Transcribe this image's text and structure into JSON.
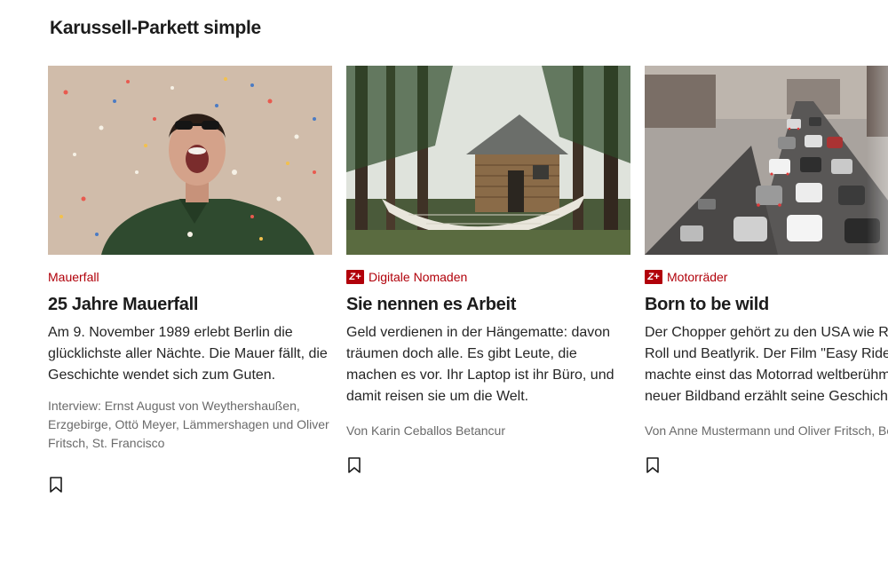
{
  "section": {
    "title": "Karussell-Parkett simple"
  },
  "cards": [
    {
      "image_alt": "Person mit Sonnenbrille jubelt im Konfettiregen",
      "zplus": false,
      "kicker": "Mauerfall",
      "headline": "25 Jahre Mauerfall",
      "teaser": "Am 9. November 1989 erlebt Berlin die glücklichste aller Nächte. Die Mauer fällt, die Geschichte wendet sich zum Guten.",
      "byline": "Interview: Ernst August von Weythershaußen, Erzgebirge, Ottö Meyer, Lämmershagen und Oliver Fritsch, St. Francisco",
      "bookmark_icon": "bookmark-icon"
    },
    {
      "image_alt": "Holzhütte mit Hängematte im Wald",
      "zplus": true,
      "zplus_label": "Z+",
      "kicker": "Digitale Nomaden",
      "headline": "Sie nennen es Arbeit",
      "teaser": "Geld verdienen in der Hängematte: davon träumen doch alle. Es gibt Leute, die machen es vor. Ihr Laptop ist ihr Büro, und damit reisen sie um die Welt.",
      "byline": "Von Karin Ceballos Betancur",
      "bookmark_icon": "bookmark-icon"
    },
    {
      "image_alt": "Dichter Straßenverkehr in einer Großstadt",
      "zplus": true,
      "zplus_label": "Z+",
      "kicker": "Motorräder",
      "headline": "Born to be wild",
      "teaser_lines": [
        "Der Chopper gehört zu den USA wie Ro",
        "Roll und Beatlyrik. Der Film \"Easy Rider\"",
        "machte einst das Motorrad weltberühm",
        "neuer Bildband erzählt seine Geschicht"
      ],
      "byline": "Von Anne Mustermann und Oliver Fritsch, Be",
      "bookmark_icon": "bookmark-icon"
    }
  ],
  "colors": {
    "kicker": "#b1000a",
    "zplus_bg": "#b1000a",
    "text": "#1c1c1c",
    "byline": "#6a6a6a"
  }
}
